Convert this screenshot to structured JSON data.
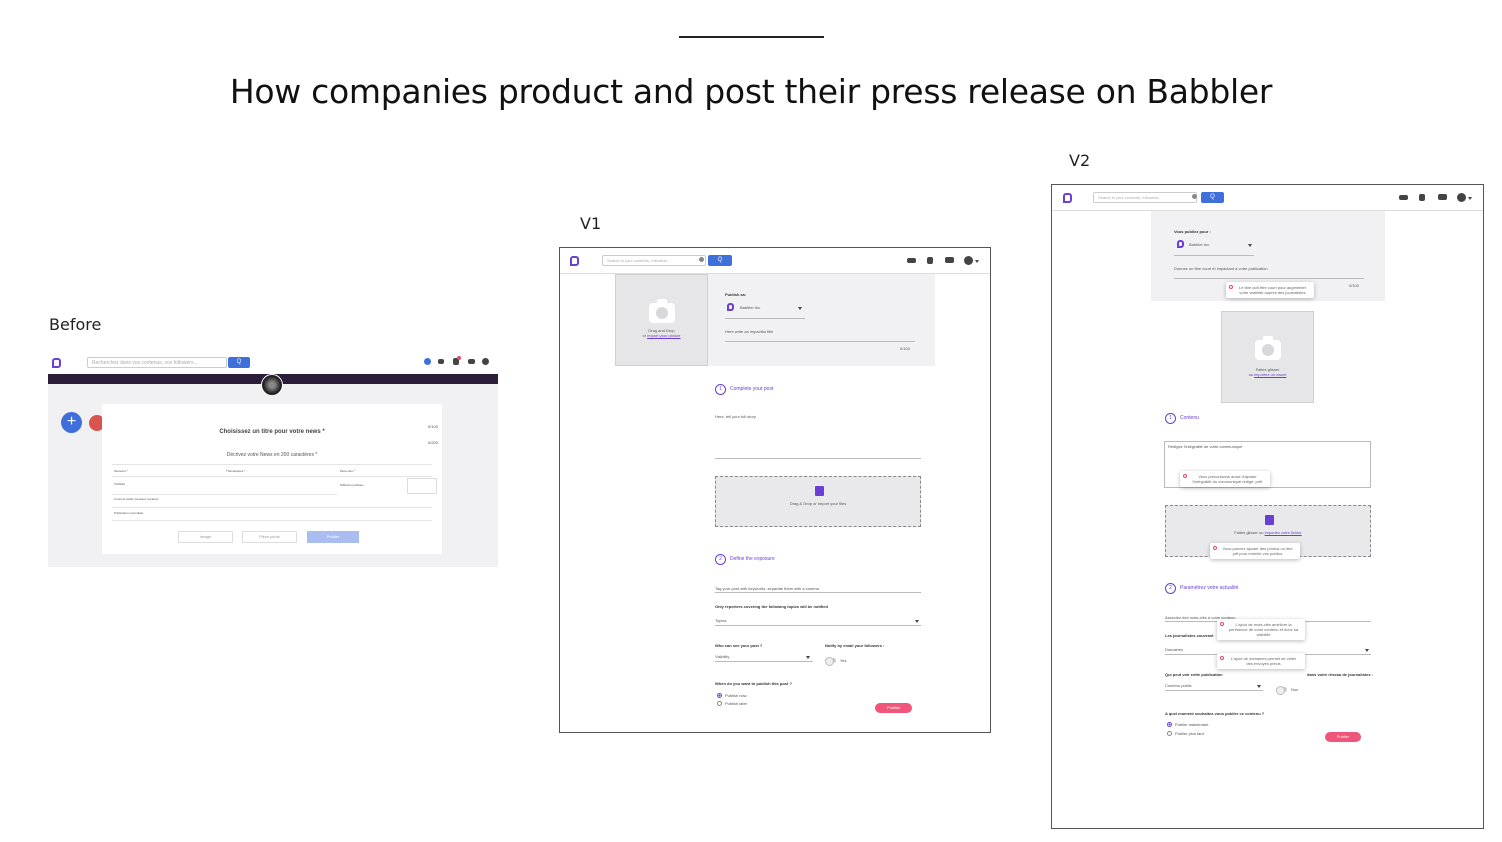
{
  "page": {
    "title": "How companies product and post their press release on Babbler",
    "labels": {
      "before": "Before",
      "v1": "V1",
      "v2": "V2"
    }
  },
  "before": {
    "search_placeholder": "Recherchez dans vos contenus, vos followers...",
    "search_button": "Q",
    "form_title": "Choisissez un titre pour votre news *",
    "form_subtitle": "Décrivez votre News en 200 caractères *",
    "counter_top": "0/100",
    "counter_mid": "0/200",
    "field_sectors": "Secteurs *",
    "field_thematic": "Thématiques *",
    "field_keywords": "Mots-clés *",
    "field_visibility": "Visibilité",
    "field_public": "Diffusion publique",
    "field_connect": "Connect public (réseaux sociaux)",
    "field_publication": "Publication immédiate",
    "btn_image": "Image",
    "btn_attach": "Pièce jointe",
    "btn_publish": "Publier"
  },
  "v1": {
    "search_placeholder": "Search in your contents, followers...",
    "search_button": "Q",
    "drop_image_line1": "Drag and Drop",
    "drop_image_prefix": "or",
    "drop_image_link": "Import your picture",
    "publish_as_label": "Publish as:",
    "publish_as_value": "Babbler Inc",
    "title_placeholder": "Here write an impactful title",
    "title_counter": "0/100",
    "step1": "Complete your post",
    "step1_num": "1",
    "story_placeholder": "Here, tell your full story",
    "files_drop": "Drag & Drop or Import your files",
    "step2": "Define the exposure",
    "step2_num": "2",
    "tag_placeholder": "Tag your post with keywords, separate them with a comma",
    "reporters_label": "Only reporters covering the following topics will be notified",
    "topics_value": "Topics",
    "who_label": "Who can see your post ?",
    "who_value": "Visibility",
    "notify_label": "Notify by email your followers :",
    "notify_value": "Yes",
    "when_label": "When do you want to publish this post ?",
    "opt_now": "Publish now",
    "opt_later": "Publish later",
    "publish_button": "Publish"
  },
  "v2": {
    "search_placeholder": "Search in your contents, followers...",
    "search_button": "Q",
    "publish_as_label": "Vous publiez pour :",
    "publish_as_value": "Babbler Inc",
    "title_placeholder": "Donnez un titre court et impactant à votre publication",
    "title_counter": "0/100",
    "tip_title": "Le titre doit être court pour augmenter votre visibilité auprès des journalistes",
    "drop_image_line1": "Faites glisser",
    "drop_image_prefix": "ou",
    "drop_image_link": "importez un visuel",
    "step1": "Contenu",
    "step1_num": "1",
    "content_placeholder": "Rédigez l'intégralité de votre communiqué",
    "tip_content": "Vous préconisons aussi d'ajouter l'intégralité du communiqué rédigé, prêt",
    "files_drop_prefix": "Faites glisser ou",
    "files_drop_link": "importez votre fichier",
    "tip_files": "Vous pouvez ajouter des photos ou des pdf pour enrichir vos publics",
    "step2": "Paramétrez votre actualité",
    "step2_num": "2",
    "keywords_placeholder": "Associez des mots-clés à votre contenu",
    "tip_keywords": "L'ajout de mots-clés améliore la pertinence de votre contenu et donc sa visibilité",
    "journalists_label": "Les journalistes couvrant",
    "domains_value": "Domaines",
    "tip_domains": "L'ajout de domaines permet de cibler des envoyés précis",
    "who_label": "Qui peut voir cette publication",
    "network_label": "dans votre réseau de journalistes :",
    "who_value": "Contenu public",
    "network_value": "Non",
    "when_label": "A quel moment souhaitez-vous publier ce contenu ?",
    "opt_now": "Publier maintenant",
    "opt_later": "Publier plus tard",
    "publish_button": "Publier"
  },
  "colors": {
    "brand_purple": "#6b3fd4",
    "search_blue": "#3e6fdb",
    "publish_pink": "#f0557a",
    "before_fab_blue": "#3e6fdb",
    "before_fab_red": "#d9534f",
    "before_banner": "#2c1e3b"
  },
  "icons": [
    "logo-icon",
    "settings-icon",
    "search-icon",
    "people-icon",
    "bell-icon",
    "mail-icon",
    "account-icon",
    "camera-icon",
    "file-icon",
    "plus-icon",
    "info-icon"
  ]
}
